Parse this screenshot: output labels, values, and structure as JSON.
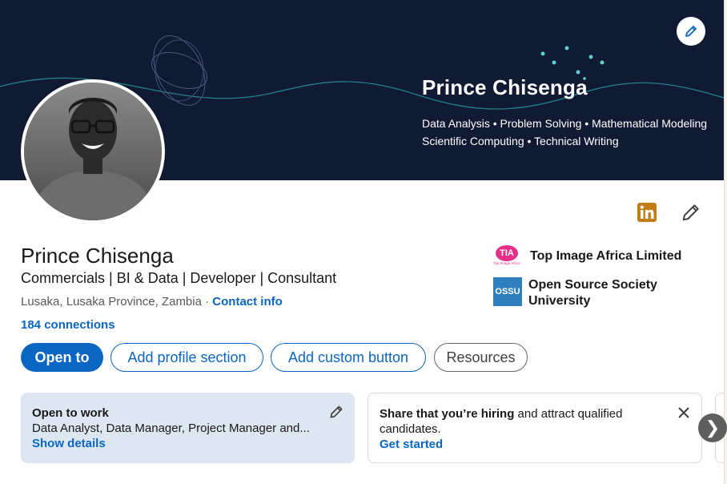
{
  "banner": {
    "name": "Prince Chisenga",
    "tagline_1": "Data Analysis • Problem Solving • Mathematical Modeling",
    "tagline_2": "Scientific Computing • Technical Writing",
    "edit_icon": "pencil-icon"
  },
  "profile": {
    "name": "Prince Chisenga",
    "headline": "Commercials | BI & Data | Developer | Consultant",
    "location": "Lusaka, Lusaka Province, Zambia",
    "separator": " · ",
    "contact_info": "Contact info",
    "connections": "184 connections"
  },
  "icons": {
    "linkedin": "linkedin-icon",
    "edit": "pencil-icon",
    "linkedin_color": "#c37d16"
  },
  "organizations": [
    {
      "logo_text": "TIA",
      "logo_subtext": "Top Image Africa",
      "name": "Top Image Africa Limited"
    },
    {
      "logo_text": "OSSU",
      "name_line1": "Open Source Society",
      "name_line2": "University"
    }
  ],
  "actions": {
    "open_to": "Open to",
    "add_section": "Add profile section",
    "add_custom": "Add custom button",
    "resources": "Resources"
  },
  "open_to_work": {
    "title": "Open to work",
    "roles": "Data Analyst, Data Manager, Project Manager and...",
    "show_details": "Show details"
  },
  "hiring": {
    "bold": "Share that you’re hiring",
    "rest": " and attract qualified",
    "line2": "candidates.",
    "cta": "Get started"
  },
  "colors": {
    "accent": "#0a66c2",
    "banner_bg": "#101b33",
    "open_to_work_bg": "#dde7f1"
  }
}
